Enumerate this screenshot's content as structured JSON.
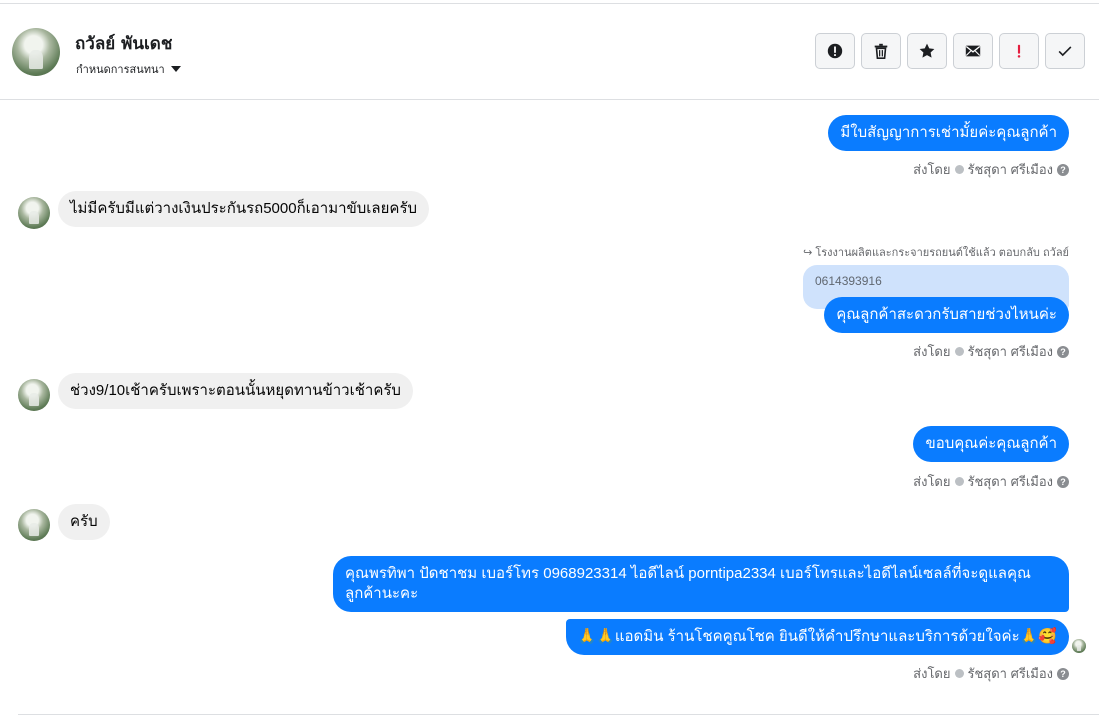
{
  "header": {
    "contact_name": "ถวัลย์ พันเดช",
    "set_conversation": "กำหนดการสนทนา",
    "actions": [
      "alert-circle-icon",
      "trash-icon",
      "star-icon",
      "envelope-icon",
      "exclamation-icon",
      "check-icon"
    ]
  },
  "sent_by_label": "ส่งโดย",
  "agent_name": "รัชสุดา ศรีเมือง",
  "reply_note": "โรงงานผลิตและกระจายรถยนต์ใช้แล้ว ตอบกลับ ถวัลย์",
  "quoted_text": "0614393916",
  "messages": [
    {
      "dir": "out",
      "text": "มีใบสัญญาการเช่ามั้ยค่ะคุณลูกค้า"
    },
    {
      "dir": "in",
      "text": "ไม่มีครับมีแต่วางเงินประกันรถ5000ก็เอามาขับเลยครับ"
    },
    {
      "dir": "out",
      "text": "คุณลูกค้าสะดวกรับสายช่วงไหนค่ะ"
    },
    {
      "dir": "in",
      "text": "ช่วง9/10เช้าครับเพราะตอนนั้นหยุดทานข้าวเช้าครับ"
    },
    {
      "dir": "out",
      "text": "ขอบคุณค่ะคุณลูกค้า"
    },
    {
      "dir": "in",
      "text": "ครับ"
    },
    {
      "dir": "out",
      "text": "คุณพรทิพา ปัดชาชม      เบอร์โทร 0968923314  ไอดีไลน์ porntipa2334  เบอร์โทรและไอดีไลน์เซลล์ที่จะดูแลคุณลูกค้านะคะ"
    },
    {
      "dir": "out",
      "text": "🙏🙏แอดมิน ร้านโชคคูณโชค ยินดีให้คำปรึกษาและบริการด้วยใจค่ะ🙏🥰"
    }
  ]
}
